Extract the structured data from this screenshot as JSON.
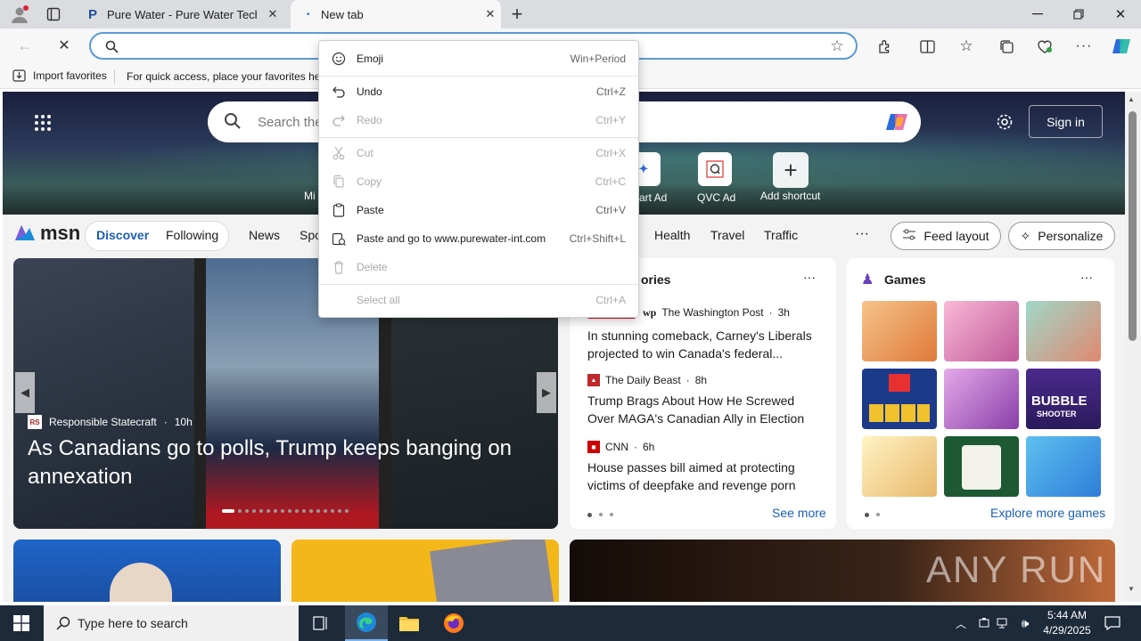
{
  "browser": {
    "tabs": [
      {
        "title": "Pure Water - Pure Water Technolo"
      },
      {
        "title": "New tab"
      }
    ],
    "address": {
      "value": "",
      "placeholder": ""
    },
    "favorites": {
      "import_label": "Import favorites",
      "hint": "For quick access, place your favorites her"
    }
  },
  "context_menu": {
    "items": [
      {
        "label": "Emoji",
        "shortcut": "Win+Period"
      },
      {
        "label": "Undo",
        "shortcut": "Ctrl+Z"
      },
      {
        "label": "Redo",
        "shortcut": "Ctrl+Y"
      },
      {
        "label": "Cut",
        "shortcut": "Ctrl+X"
      },
      {
        "label": "Copy",
        "shortcut": "Ctrl+C"
      },
      {
        "label": "Paste",
        "shortcut": "Ctrl+V"
      },
      {
        "label": "Paste and go to www.purewater-int.com",
        "shortcut": "Ctrl+Shift+L"
      },
      {
        "label": "Delete",
        "shortcut": ""
      },
      {
        "label": "Select all",
        "shortcut": "Ctrl+A"
      }
    ]
  },
  "newtab": {
    "search_placeholder": "Search the",
    "sign_in": "Sign in",
    "shortcuts": [
      {
        "label": "art Ad"
      },
      {
        "label": "QVC Ad"
      },
      {
        "label": "Add shortcut"
      }
    ],
    "mi_label": "Mi"
  },
  "msn": {
    "logo": "msn",
    "tabs": [
      "Discover",
      "Following"
    ],
    "nav": [
      "News",
      "Spo",
      "Health",
      "Travel",
      "Traffic"
    ],
    "feed_layout": "Feed layout",
    "personalize": "Personalize",
    "hero": {
      "source": "Responsible Statecraft",
      "time": "10h",
      "headline": "As Canadians go to polls, Trump keeps banging on annexation",
      "source_badge": "RS"
    },
    "top_stories": {
      "title": "ories",
      "items": [
        {
          "source": "The Washington Post",
          "time": "3h",
          "headline": "In stunning comeback, Carney's Liberals projected to win Canada's federal..."
        },
        {
          "source": "The Daily Beast",
          "time": "8h",
          "headline": "Trump Brags About How He Screwed Over MAGA's Canadian Ally in Election"
        },
        {
          "source": "CNN",
          "time": "6h",
          "headline": "House passes bill aimed at protecting victims of deepfake and revenge porn"
        }
      ],
      "see_more": "See more"
    },
    "games": {
      "title": "Games",
      "explore": "Explore more games",
      "bubble_title": "BUBBLE",
      "bubble_sub": "SHOOTER"
    }
  },
  "watermark": "ANY RUN",
  "taskbar": {
    "search_placeholder": "Type here to search",
    "time": "5:44 AM",
    "date": "4/29/2025"
  }
}
